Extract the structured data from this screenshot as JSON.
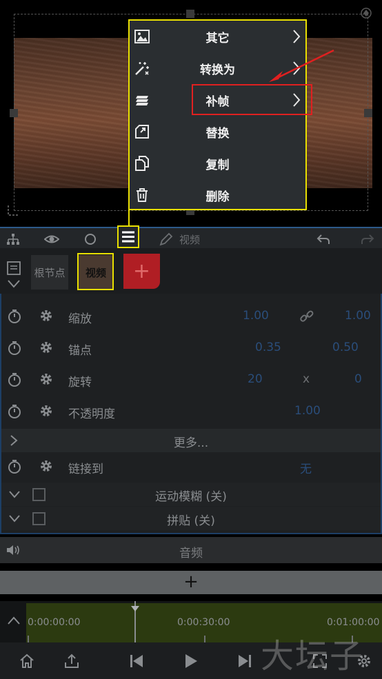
{
  "menu": {
    "items": [
      {
        "label": "其它",
        "icon": "image-icon",
        "submenu": true
      },
      {
        "label": "转换为",
        "icon": "magic-wand-icon",
        "submenu": true
      },
      {
        "label": "补帧",
        "icon": "layers-icon",
        "submenu": true
      },
      {
        "label": "替换",
        "icon": "replace-icon",
        "submenu": false
      },
      {
        "label": "复制",
        "icon": "copy-icon",
        "submenu": false
      },
      {
        "label": "删除",
        "icon": "trash-icon",
        "submenu": false
      }
    ]
  },
  "toolbar": {
    "title": "视频"
  },
  "nodes": {
    "root_label": "根节点",
    "active_label": "视频",
    "add_label": "+"
  },
  "properties": {
    "scale": {
      "label": "缩放",
      "x": "1.00",
      "y": "1.00"
    },
    "anchor": {
      "label": "锚点",
      "x": "0.35",
      "y": "0.50"
    },
    "rotation": {
      "label": "旋转",
      "x": "20",
      "sep": "x",
      "y": "0"
    },
    "opacity": {
      "label": "不透明度",
      "value": "1.00"
    },
    "more_label": "更多...",
    "link": {
      "label": "链接到",
      "value": "无"
    },
    "motion_blur": "运动模糊 (关)",
    "tile": "拼贴 (关)"
  },
  "audio": {
    "label": "音频"
  },
  "add_bar": {
    "label": "+"
  },
  "timeline": {
    "t0": "0:00:00:00",
    "t1": "0:00:30:00",
    "t2": "0:01:00:00"
  },
  "watermark": "大坛子",
  "colors": {
    "highlight": "#e9e000",
    "annotation": "#e02020",
    "accent": "#2c5a8a"
  }
}
